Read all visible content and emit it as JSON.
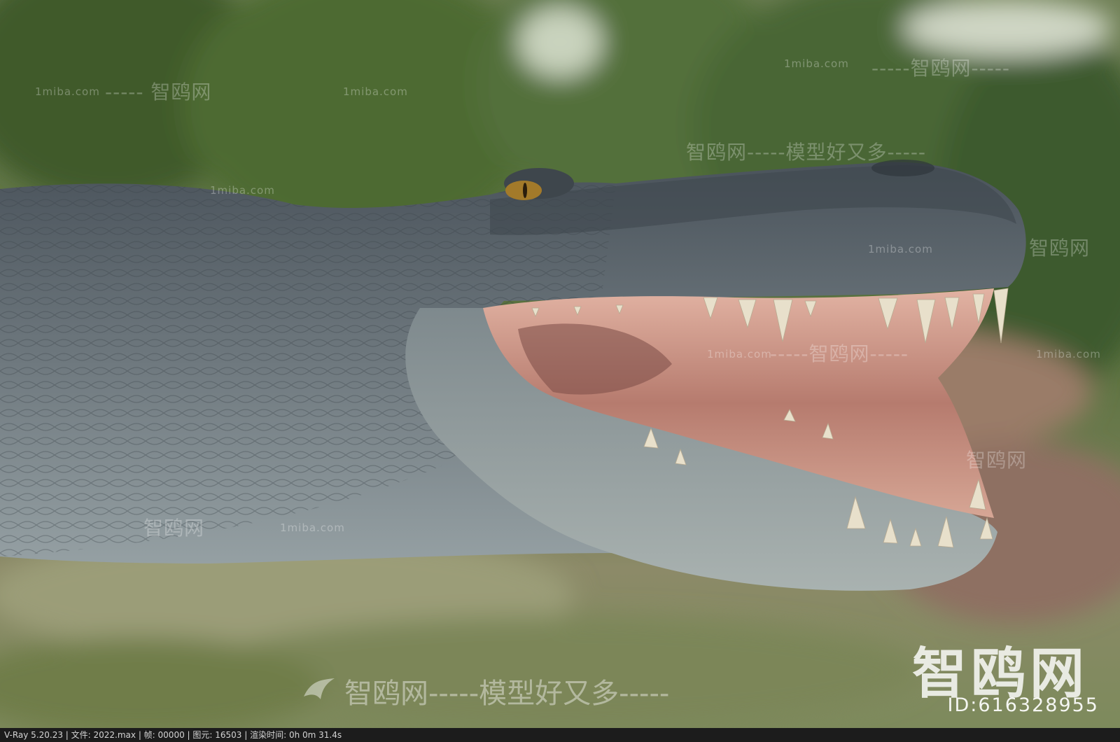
{
  "watermarks": {
    "site_small": "1miba.com",
    "brand_cn": "智鸥网",
    "brand_line_1": "-----  智鸥网",
    "brand_line_2": "智鸥网-----模型好又多-----",
    "brand_line_3": "-----智鸥网-----",
    "brand_line_4": "智鸥网-----模型好又多-----",
    "big_cn": "智鸥网",
    "id_text": "ID:616328955"
  },
  "statusbar": {
    "text": "V-Ray 5.20.23 | 文件: 2022.max | 帧: 00000 | 图元: 16503 | 渲染时间:  0h  0m 31.4s"
  },
  "colors": {
    "hide_base": "#566068",
    "hide_light": "#8b969c",
    "mouth_pink": "#c99486",
    "teeth": "#e6ddc8",
    "foliage": "#4e6a36",
    "ground": "#8a8f6a"
  }
}
